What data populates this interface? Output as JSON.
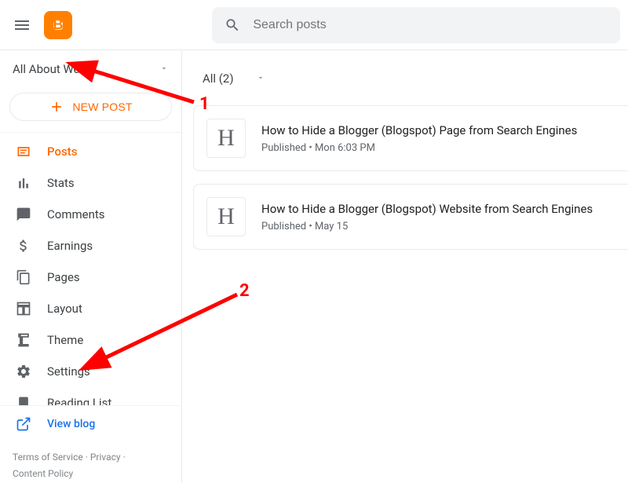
{
  "search": {
    "placeholder": "Search posts"
  },
  "blog": {
    "name": "All About Web"
  },
  "newPost": {
    "label": "NEW POST"
  },
  "nav": {
    "posts": "Posts",
    "stats": "Stats",
    "comments": "Comments",
    "earnings": "Earnings",
    "pages": "Pages",
    "layout": "Layout",
    "theme": "Theme",
    "settings": "Settings",
    "readingList": "Reading List"
  },
  "viewBlog": {
    "label": "View blog"
  },
  "footer": {
    "terms": "Terms of Service",
    "privacy": "Privacy",
    "content": "Content Policy",
    "sep": "  ·  "
  },
  "filter": {
    "label": "All (2)"
  },
  "posts": [
    {
      "thumb": "H",
      "title": "How to Hide a Blogger (Blogspot) Page from Search Engines",
      "status": "Published",
      "sep": " • ",
      "date": "Mon 6:03 PM"
    },
    {
      "thumb": "H",
      "title": "How to Hide a Blogger (Blogspot) Website from Search Engines",
      "status": "Published",
      "sep": " • ",
      "date": "May 15"
    }
  ],
  "annotations": {
    "one": "1",
    "two": "2"
  }
}
